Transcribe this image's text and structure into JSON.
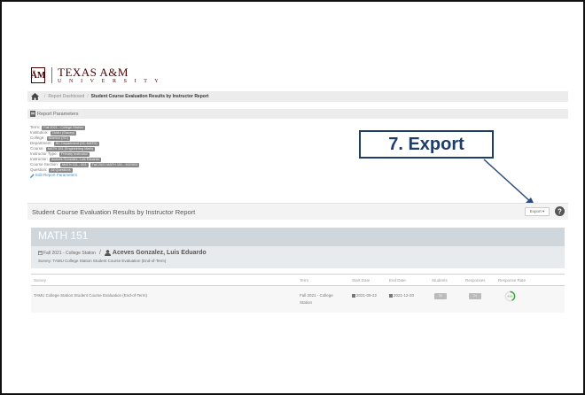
{
  "brand": {
    "logo_text": "ĀM",
    "name": "TEXAS A&M",
    "sub": "U N I V E R S I T Y"
  },
  "breadcrumb": {
    "dashboard": "Report Dashboard",
    "current": "Student Course Evaluation Results by Instructor Report"
  },
  "params": {
    "header": "Report Parameters",
    "rows": [
      {
        "label": "Term:",
        "values": [
          "Fall 2021 - College Station"
        ]
      },
      {
        "label": "Institution:",
        "values": [
          "TAMU (Stacey)"
        ]
      },
      {
        "label": "College:",
        "values": [
          "Science (SC)"
        ]
      },
      {
        "label": "Department:",
        "values": [
          "SC Department (SC-MATH)"
        ]
      },
      {
        "label": "Course:",
        "values": [
          "MATH 151 (Engineering Math)"
        ]
      },
      {
        "label": "Instructor Type:",
        "values": [
          "Primary Instructor"
        ]
      },
      {
        "label": "Instructor:",
        "values": [
          "Aceves Gonzalez, Luis Eduardo"
        ]
      },
      {
        "label": "Course Section:",
        "values": [
          "MATH 151 - 501",
          "Fall 2021 MATH 151 - 502/503"
        ]
      },
      {
        "label": "Question:",
        "values": [
          "All Questions"
        ]
      }
    ],
    "edit_link": "Edit Report Parameters"
  },
  "report": {
    "title": "Student Course Evaluation Results by Instructor Report",
    "export_label": "Export ▾"
  },
  "callout": {
    "label": "7. Export"
  },
  "course": {
    "code": "MATH 151",
    "term": "Fall 2021 - College Station",
    "instructor": "Aceves Gonzalez, Luis Eduardo",
    "survey": "Survey: TAMU College Station Student Course Evaluation (End-of-Term)"
  },
  "table": {
    "headers": {
      "survey": "Survey",
      "term": "Term",
      "start": "Start Date",
      "end": "End Date",
      "students": "Students",
      "responses": "Responses",
      "rate": "Response Rate"
    },
    "rows": [
      {
        "survey": "TAMU College Station Student Course Evaluation (End-of-Term)",
        "term_line1": "Fall 2021 - College",
        "term_line2": "Station",
        "start": "2021-09-22",
        "end": "2021-12-20",
        "students": "56",
        "responses": "24",
        "rate": "43%",
        "rate_fraction": 0.43
      }
    ]
  },
  "colors": {
    "maroon": "#500000",
    "callout_border": "#1f3d6b",
    "callout_text": "#1f3d6b",
    "arrow": "#2c4a7a",
    "rate_green": "#3aa63a"
  }
}
